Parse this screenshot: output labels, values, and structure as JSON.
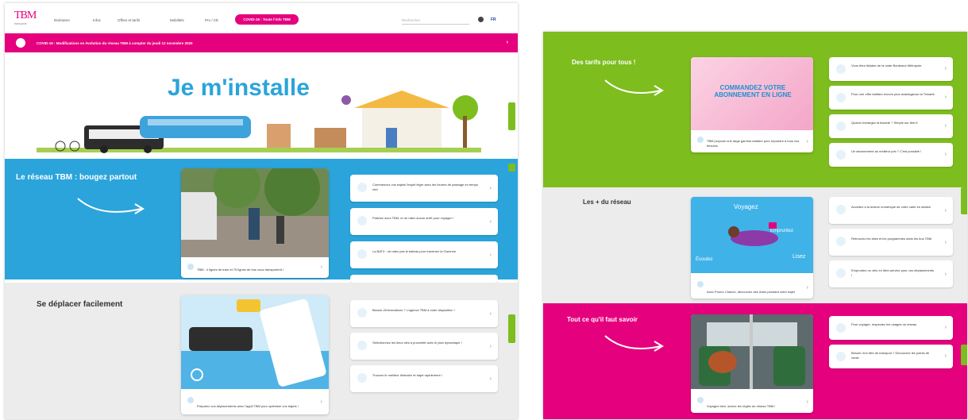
{
  "header": {
    "logo_text": "TBM",
    "logo_sub": "transports",
    "nav": [
      "Itinéraires",
      "Infos",
      "Offres et tarifs",
      "Mobilités",
      "Pro / CE"
    ],
    "covid_button": "COVID-19 : Toute l'info TBM",
    "search_placeholder": "Rechercher",
    "lang": "FR"
  },
  "alert": {
    "text": "COVID-19 : Modifications en évolution du réseau TBM à compter du jeudi 12 novembre 2020"
  },
  "hero": {
    "title": "Je m'installe"
  },
  "sections": {
    "reseau": {
      "title": "Le réseau TBM : bougez partout",
      "feature_caption": "TBM : 4 lignes de tram et 75 lignes de bus vous transportent !",
      "links": [
        "Commencez vos trajets l'esprit léger avec les heures de passage en temps réel",
        "Flashez avec TBM, et ne ratez aucun arrêt pour voyager !",
        "La BAT3 : ne ratez pas le bateau pour traverser la Garonne",
        ""
      ]
    },
    "deplacer": {
      "title": "Se déplacer facilement",
      "feature_caption": "Préparez vos déplacements avec l'appli TBM pour optimiser vos trajets !",
      "links": [
        "Besoin d'informations ? L'agence TBM à votre disposition !",
        "Sélectionnez les lieux clés à proximité avec le plan dynamique !",
        "Trouvez le meilleur itinéraire et trajet rapidement !"
      ]
    },
    "tarifs": {
      "title": "Des tarifs pour tous !",
      "banner_text": "COMMANDEZ VOTRE ABONNEMENT EN LIGNE",
      "feature_caption": "TBM propose une large gamme tarifaire pour répondre à tous vos besoins",
      "links": [
        "Vous êtes titulaire de la carte Bordeaux Métropole",
        "Pour une offre tarifaire encore plus avantageuse la Tickarte",
        "Quand rechargez la tickarte ? Simple sur tbm.fr",
        "Un abonnement au meilleur prix ? C'est possible !"
      ]
    },
    "plus": {
      "title": "Les + du réseau",
      "banner_words": [
        "Voyagez",
        "Empruntez",
        "Écoutez",
        "Lisez"
      ],
      "feature_caption": "Avec Promo Chance, découvrez des livres pendant votre trajet",
      "links": [
        "Accédez à la lecture numérique de votre carte en station",
        "Retrouvez les sites et les programmes dans les bus TBM",
        "Empruntez un vélo en libre-service pour vos déplacements !"
      ]
    },
    "savoir": {
      "title": "Tout ce qu'il faut savoir",
      "feature_caption": "Voyagez bien, suivez les règles du réseau TBM !",
      "links": [
        "Pour voyager, respectez les usages du réseau",
        "Besoin d'un titre de transport ? Découvrez les points de vente"
      ]
    }
  },
  "colors": {
    "pink": "#e5007e",
    "blue": "#2ba4db",
    "green": "#7dbd1e",
    "grey": "#ececec"
  }
}
